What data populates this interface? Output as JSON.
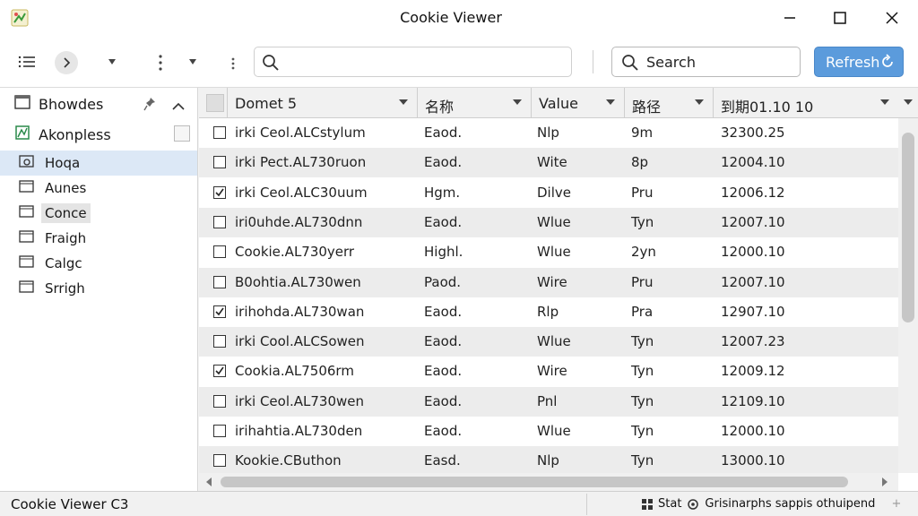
{
  "window": {
    "title": "Cookie Viewer"
  },
  "toolbar": {
    "search_label": "Search",
    "refresh_label": "Refresh"
  },
  "sidebar": {
    "items": [
      {
        "label": "Bhowdes",
        "icon": "browser-icon",
        "level": 0
      },
      {
        "label": "Akonpless",
        "icon": "bookmark-icon",
        "level": 0
      },
      {
        "label": "Hoqa",
        "icon": "folder-search-icon",
        "level": 1,
        "selected": true
      },
      {
        "label": "Aunes",
        "icon": "folder-icon",
        "level": 1
      },
      {
        "label": "Conce",
        "icon": "folder-icon",
        "level": 1
      },
      {
        "label": "Fraigh",
        "icon": "folder-icon",
        "level": 1
      },
      {
        "label": "Calgc",
        "icon": "folder-icon",
        "level": 1
      },
      {
        "label": "Srrigh",
        "icon": "folder-icon",
        "level": 1
      }
    ]
  },
  "table": {
    "columns": [
      "Domet 5",
      "名称",
      "Value",
      "路径",
      "到期01.10 10"
    ],
    "rows": [
      {
        "checked": false,
        "domain": "irki Ceol.ALCstylum",
        "name": "Eaod.",
        "value": "Nlp",
        "path": "9m",
        "expires": "32300.25"
      },
      {
        "checked": false,
        "domain": "irki Pect.AL730ruon",
        "name": "Eaod.",
        "value": "Wite",
        "path": "8p",
        "expires": "12004.10"
      },
      {
        "checked": true,
        "domain": "irki Ceol.ALC30uum",
        "name": "Hgm.",
        "value": "Dilve",
        "path": "Pru",
        "expires": "12006.12"
      },
      {
        "checked": false,
        "domain": "iri0uhde.AL730dnn",
        "name": "Eaod.",
        "value": "Wlue",
        "path": "Tyn",
        "expires": "12007.10"
      },
      {
        "checked": false,
        "domain": "Cookie.AL730yerr",
        "name": "Highl.",
        "value": "Wlue",
        "path": "2yn",
        "expires": "12000.10"
      },
      {
        "checked": false,
        "domain": "B0ohtia.AL730wen",
        "name": "Paod.",
        "value": "Wire",
        "path": "Pru",
        "expires": "12007.10"
      },
      {
        "checked": true,
        "domain": "irihohda.AL730wan",
        "name": "Eaod.",
        "value": "Rlp",
        "path": "Pra",
        "expires": "12907.10"
      },
      {
        "checked": false,
        "domain": "irki Cool.ALCSowen",
        "name": "Eaod.",
        "value": "Wlue",
        "path": "Tyn",
        "expires": "12007.23"
      },
      {
        "checked": true,
        "domain": "Cookia.AL7506rm",
        "name": "Eaod.",
        "value": "Wire",
        "path": "Tyn",
        "expires": "12009.12"
      },
      {
        "checked": false,
        "domain": "irki Ceol.AL730wen",
        "name": "Eaod.",
        "value": "Pnl",
        "path": "Tyn",
        "expires": "12109.10"
      },
      {
        "checked": false,
        "domain": "irihahtia.AL730den",
        "name": "Eaod.",
        "value": "Wlue",
        "path": "Tyn",
        "expires": "12000.10"
      },
      {
        "checked": false,
        "domain": "Kookie.CButhon",
        "name": "Easd.",
        "value": "Nlp",
        "path": "Tyn",
        "expires": "13000.10"
      }
    ]
  },
  "statusbar": {
    "left": "Cookie Viewer C3",
    "stat_label": "Stat",
    "right_text": "Grisinarphs sappis othuipend"
  },
  "colors": {
    "accent": "#5b9bdc",
    "selection": "#dce8f6",
    "row_alt": "#ececec"
  }
}
